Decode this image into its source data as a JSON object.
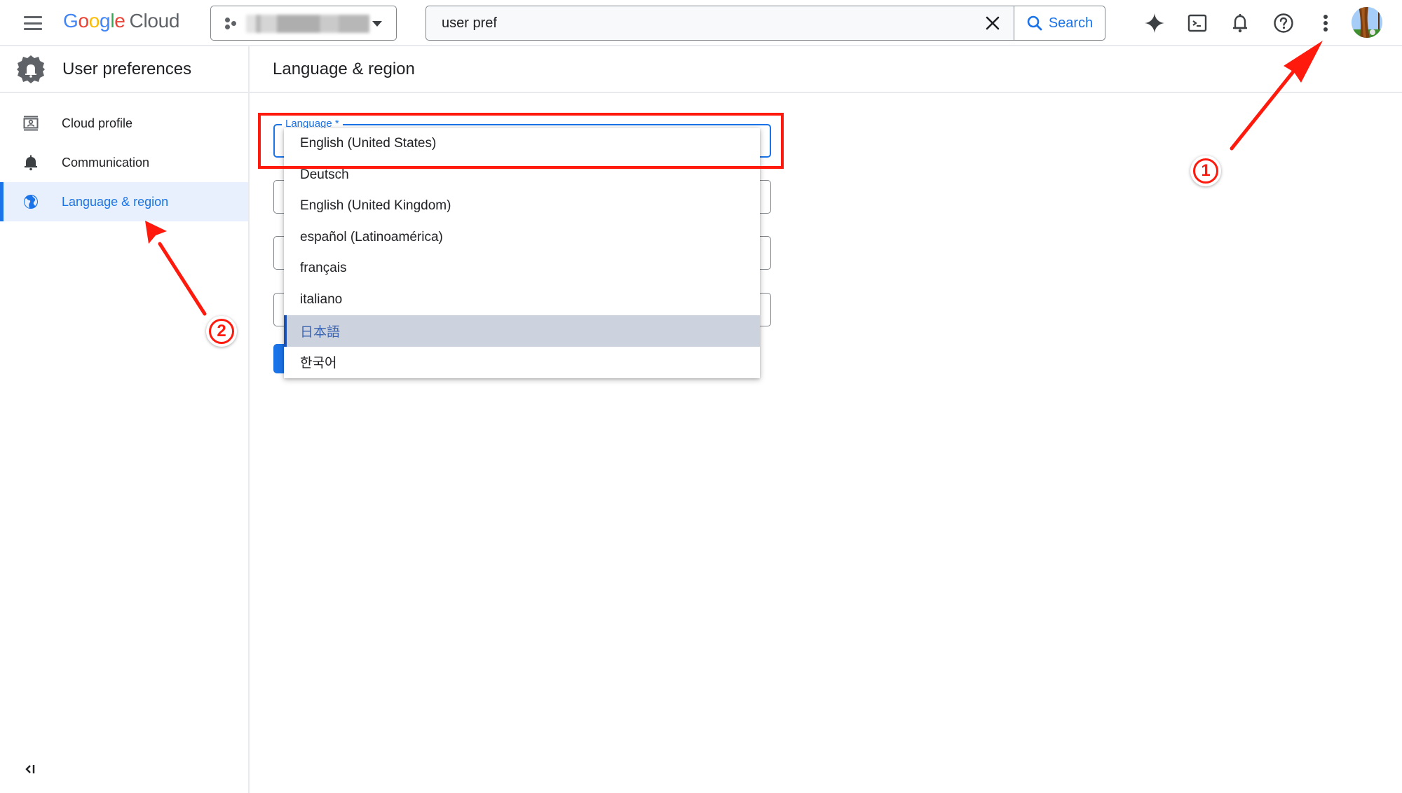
{
  "topbar": {
    "menu_icon": "hamburger-menu-icon",
    "logo": {
      "google_letters": [
        "G",
        "o",
        "o",
        "g",
        "l",
        "e"
      ],
      "product": "Cloud"
    },
    "project_picker": {
      "icon": "project-dots-icon",
      "value_redacted": true
    },
    "search": {
      "value": "user pref",
      "clear_icon": "close-icon",
      "button_label": "Search",
      "button_icon": "search-icon"
    },
    "actions": [
      {
        "name": "gemini-sparkle-icon"
      },
      {
        "name": "cloud-shell-terminal-icon"
      },
      {
        "name": "notifications-bell-icon"
      },
      {
        "name": "help-icon"
      },
      {
        "name": "more-vert-icon"
      }
    ],
    "avatar": "user-avatar"
  },
  "sidebar": {
    "title": "User preferences",
    "title_icon": "settings-bell-icon",
    "items": [
      {
        "label": "Cloud profile",
        "icon": "profile-card-icon",
        "active": false
      },
      {
        "label": "Communication",
        "icon": "bell-icon",
        "active": false
      },
      {
        "label": "Language & region",
        "icon": "globe-icon",
        "active": true
      }
    ],
    "collapse_icon": "collapse-left-icon"
  },
  "main": {
    "title": "Language & region",
    "language_field": {
      "label": "Language *",
      "selected": "English (United States)"
    },
    "language_options": [
      {
        "label": "English (United States)",
        "highlighted": false
      },
      {
        "label": "Deutsch",
        "highlighted": false
      },
      {
        "label": "English (United Kingdom)",
        "highlighted": false
      },
      {
        "label": "español (Latinoamérica)",
        "highlighted": false
      },
      {
        "label": "français",
        "highlighted": false
      },
      {
        "label": "italiano",
        "highlighted": false
      },
      {
        "label": "日本語",
        "highlighted": true
      },
      {
        "label": "한국어",
        "highlighted": false
      }
    ]
  },
  "annotations": {
    "color": "#ff1a0d",
    "markers": [
      {
        "label": "1",
        "points_to": "more-vert-icon"
      },
      {
        "label": "2",
        "points_to": "sidebar-item-language-region"
      }
    ],
    "highlight_box": "language-field"
  },
  "colors": {
    "accent": "#1a73e8",
    "active_nav_bg": "#e8f0fe",
    "option_highlight_bg": "#cdd3de",
    "annotation_red": "#ff1a0d"
  }
}
